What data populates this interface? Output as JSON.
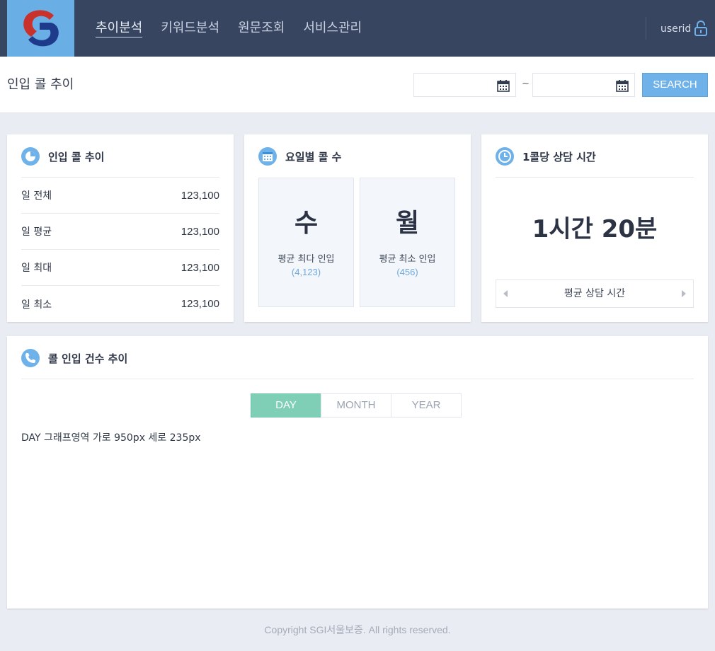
{
  "nav": {
    "items": [
      "추이분석",
      "키워드분석",
      "원문조회",
      "서비스관리"
    ],
    "active_index": 0,
    "user": "userid"
  },
  "titlebar": {
    "title": "인입 콜 추이",
    "date_from": "",
    "date_to": "",
    "separator": "~",
    "search_label": "SEARCH"
  },
  "card_inflow": {
    "title": "인입 콜 추이",
    "rows": [
      {
        "label": "일 전체",
        "value": "123,100"
      },
      {
        "label": "일 평균",
        "value": "123,100"
      },
      {
        "label": "일 최대",
        "value": "123,100"
      },
      {
        "label": "일 최소",
        "value": "123,100"
      }
    ]
  },
  "card_weekday": {
    "title": "요일별 콜 수",
    "boxes": [
      {
        "day": "수",
        "label": "평균 최다 인입",
        "count": "(4,123)"
      },
      {
        "day": "월",
        "label": "평균 최소 인입",
        "count": "(456)"
      }
    ]
  },
  "card_time": {
    "title": "1콜당 상담 시간",
    "value": "1시간 20분",
    "pager_label": "평균 상담 시간"
  },
  "card_trend": {
    "title": "콜 인입 건수 추이",
    "tabs": [
      "DAY",
      "MONTH",
      "YEAR"
    ],
    "active_tab": 0,
    "graph_note": "DAY 그래프영역 가로 950px 세로 235px"
  },
  "footer": "Copyright SGI서울보증. All rights reserved.",
  "colors": {
    "topbar": "#374560",
    "logo_bg": "#6aaee6",
    "accent_blue": "#6fb2ea",
    "tab_active": "#7ecfb5",
    "page_bg": "#e9ecf2"
  }
}
